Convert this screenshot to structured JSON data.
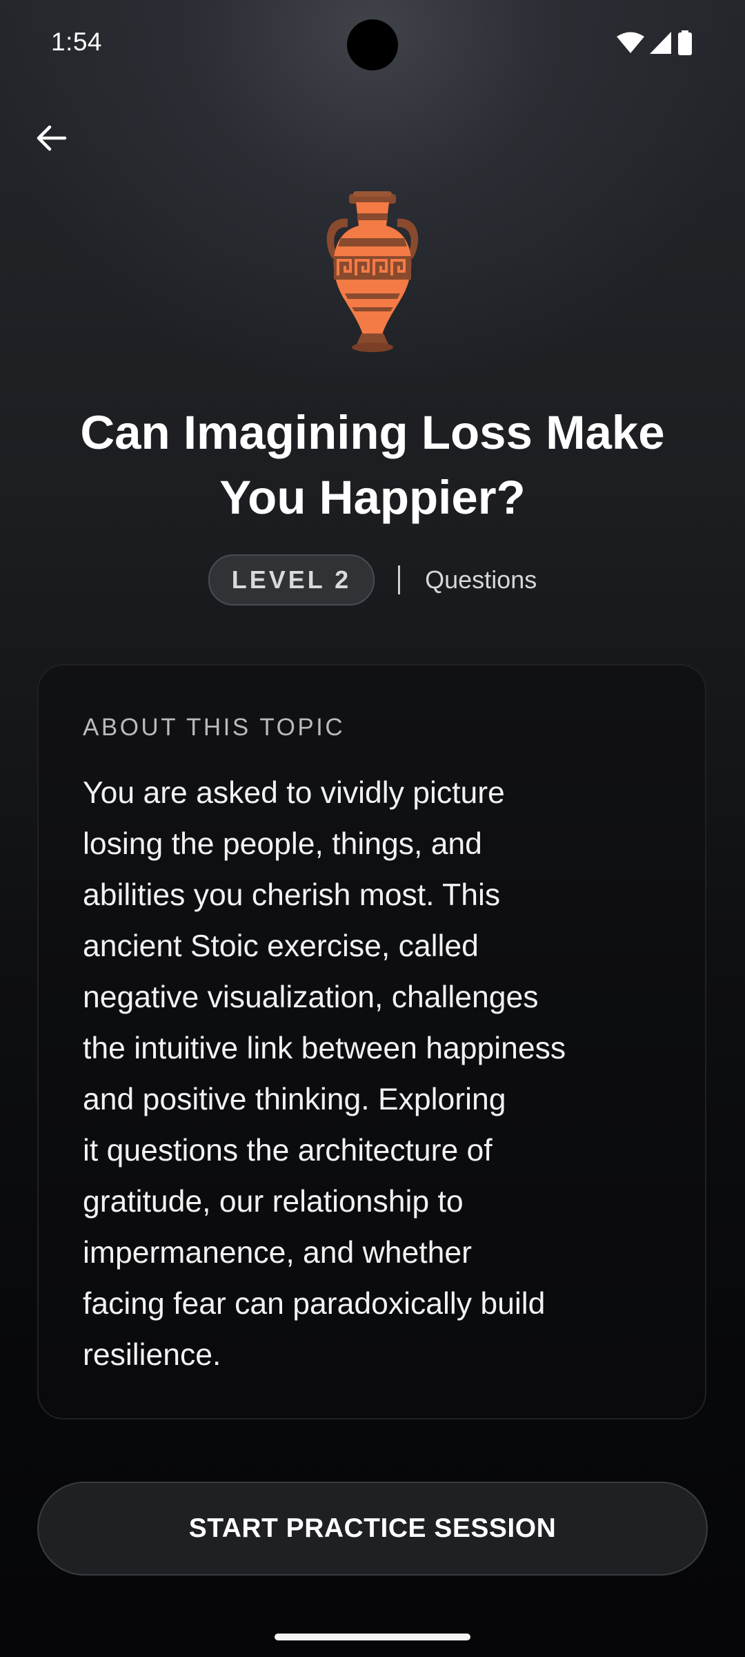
{
  "status_bar": {
    "time": "1:54",
    "icons": [
      "wifi-icon",
      "cellular-signal-icon",
      "battery-icon"
    ]
  },
  "nav": {
    "back_icon": "arrow-left-icon"
  },
  "hero": {
    "illustration": "amphora-vase-icon"
  },
  "topic": {
    "title": "Can Imagining Loss Make You Happier?",
    "level_label": "LEVEL 2",
    "type_label": "Questions"
  },
  "about": {
    "heading": "ABOUT THIS TOPIC",
    "body_lines": [
      "You are asked to vividly picture",
      "losing the people, things, and",
      "abilities you cherish most. This",
      "ancient Stoic exercise, called",
      "negative visualization, challenges",
      "the intuitive link between happiness",
      "and positive thinking. Exploring",
      "it questions the architecture of",
      "gratitude, our relationship to",
      "impermanence, and whether",
      "facing fear can paradoxically build",
      "resilience."
    ]
  },
  "actions": {
    "start_label": "START PRACTICE SESSION"
  },
  "colors": {
    "vase_orange": "#F47B45",
    "vase_brown": "#8A4A2E",
    "background_top": "#2A2D33",
    "background_bottom": "#060608"
  }
}
